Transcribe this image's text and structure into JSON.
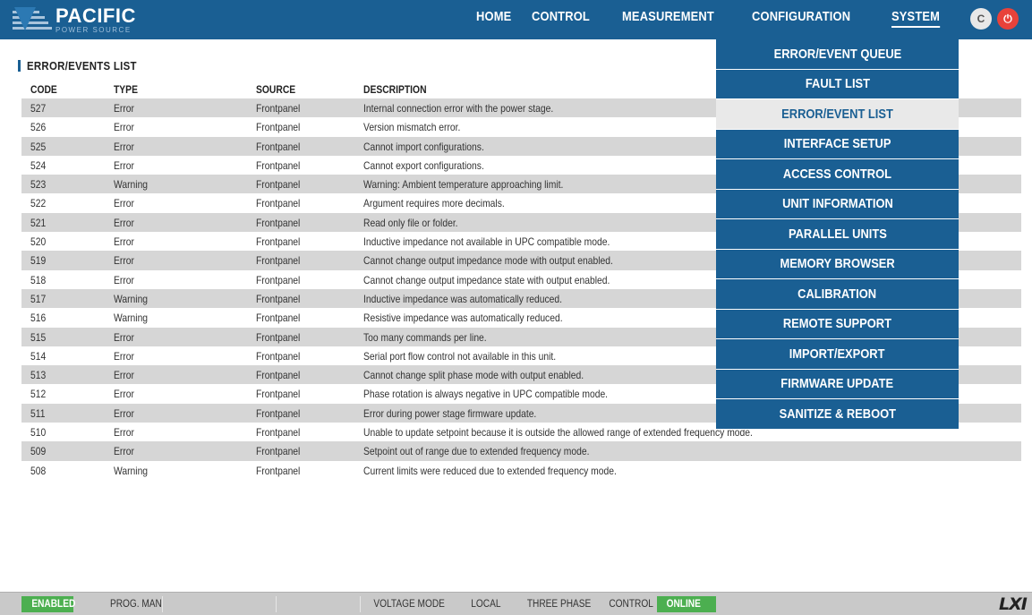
{
  "header": {
    "logo_main": "PACIFIC",
    "logo_sub": "POWER SOURCE",
    "nav": [
      "HOME",
      "CONTROL",
      "MEASUREMENT",
      "CONFIGURATION",
      "SYSTEM"
    ],
    "refresh_icon": "refresh-icon",
    "power_icon": "power-icon",
    "refresh_glyph": "C",
    "power_glyph": "⏻",
    "colors": {
      "header_bg": "#1a5f93",
      "power": "#e8423a",
      "status_green": "#4caf50"
    }
  },
  "section": {
    "title": "ERROR/EVENTS LIST"
  },
  "table": {
    "headers": [
      "CODE",
      "TYPE",
      "SOURCE",
      "DESCRIPTION"
    ],
    "rows": [
      [
        "527",
        "Error",
        "Frontpanel",
        "Internal connection error with the power stage."
      ],
      [
        "526",
        "Error",
        "Frontpanel",
        "Version mismatch error."
      ],
      [
        "525",
        "Error",
        "Frontpanel",
        "Cannot import configurations."
      ],
      [
        "524",
        "Error",
        "Frontpanel",
        "Cannot export configurations."
      ],
      [
        "523",
        "Warning",
        "Frontpanel",
        "Warning: Ambient temperature approaching limit."
      ],
      [
        "522",
        "Error",
        "Frontpanel",
        "Argument requires more decimals."
      ],
      [
        "521",
        "Error",
        "Frontpanel",
        "Read only file or folder."
      ],
      [
        "520",
        "Error",
        "Frontpanel",
        "Inductive impedance not available in UPC compatible mode."
      ],
      [
        "519",
        "Error",
        "Frontpanel",
        "Cannot change output impedance mode with output enabled."
      ],
      [
        "518",
        "Error",
        "Frontpanel",
        "Cannot change output impedance state with output enabled."
      ],
      [
        "517",
        "Warning",
        "Frontpanel",
        "Inductive impedance was automatically reduced."
      ],
      [
        "516",
        "Warning",
        "Frontpanel",
        "Resistive impedance was automatically reduced."
      ],
      [
        "515",
        "Error",
        "Frontpanel",
        "Too many commands per line."
      ],
      [
        "514",
        "Error",
        "Frontpanel",
        "Serial port flow control not available in this unit."
      ],
      [
        "513",
        "Error",
        "Frontpanel",
        "Cannot change split phase mode with output enabled."
      ],
      [
        "512",
        "Error",
        "Frontpanel",
        "Phase rotation is always negative in UPC compatible mode."
      ],
      [
        "511",
        "Error",
        "Frontpanel",
        "Error during power stage firmware update."
      ],
      [
        "510",
        "Error",
        "Frontpanel",
        "Unable to update setpoint because it is outside the allowed range of extended frequency mode."
      ],
      [
        "509",
        "Error",
        "Frontpanel",
        "Setpoint out of range due to extended frequency mode."
      ],
      [
        "508",
        "Warning",
        "Frontpanel",
        "Current limits were reduced due to extended frequency mode."
      ]
    ]
  },
  "dropdown": {
    "items": [
      "ERROR/EVENT QUEUE",
      "FAULT LIST",
      "ERROR/EVENT LIST",
      "INTERFACE SETUP",
      "ACCESS CONTROL",
      "UNIT INFORMATION",
      "PARALLEL UNITS",
      "MEMORY BROWSER",
      "CALIBRATION",
      "REMOTE SUPPORT",
      "IMPORT/EXPORT",
      "FIRMWARE UPDATE",
      "SANITIZE & REBOOT"
    ],
    "active": "ERROR/EVENT LIST"
  },
  "status": {
    "enabled": "ENABLED",
    "prog": "PROG. MAN",
    "voltage_mode": "VOLTAGE MODE",
    "local": "LOCAL",
    "phase": "THREE PHASE",
    "control": "CONTROL",
    "online": "ONLINE",
    "lxi": "LXI"
  }
}
